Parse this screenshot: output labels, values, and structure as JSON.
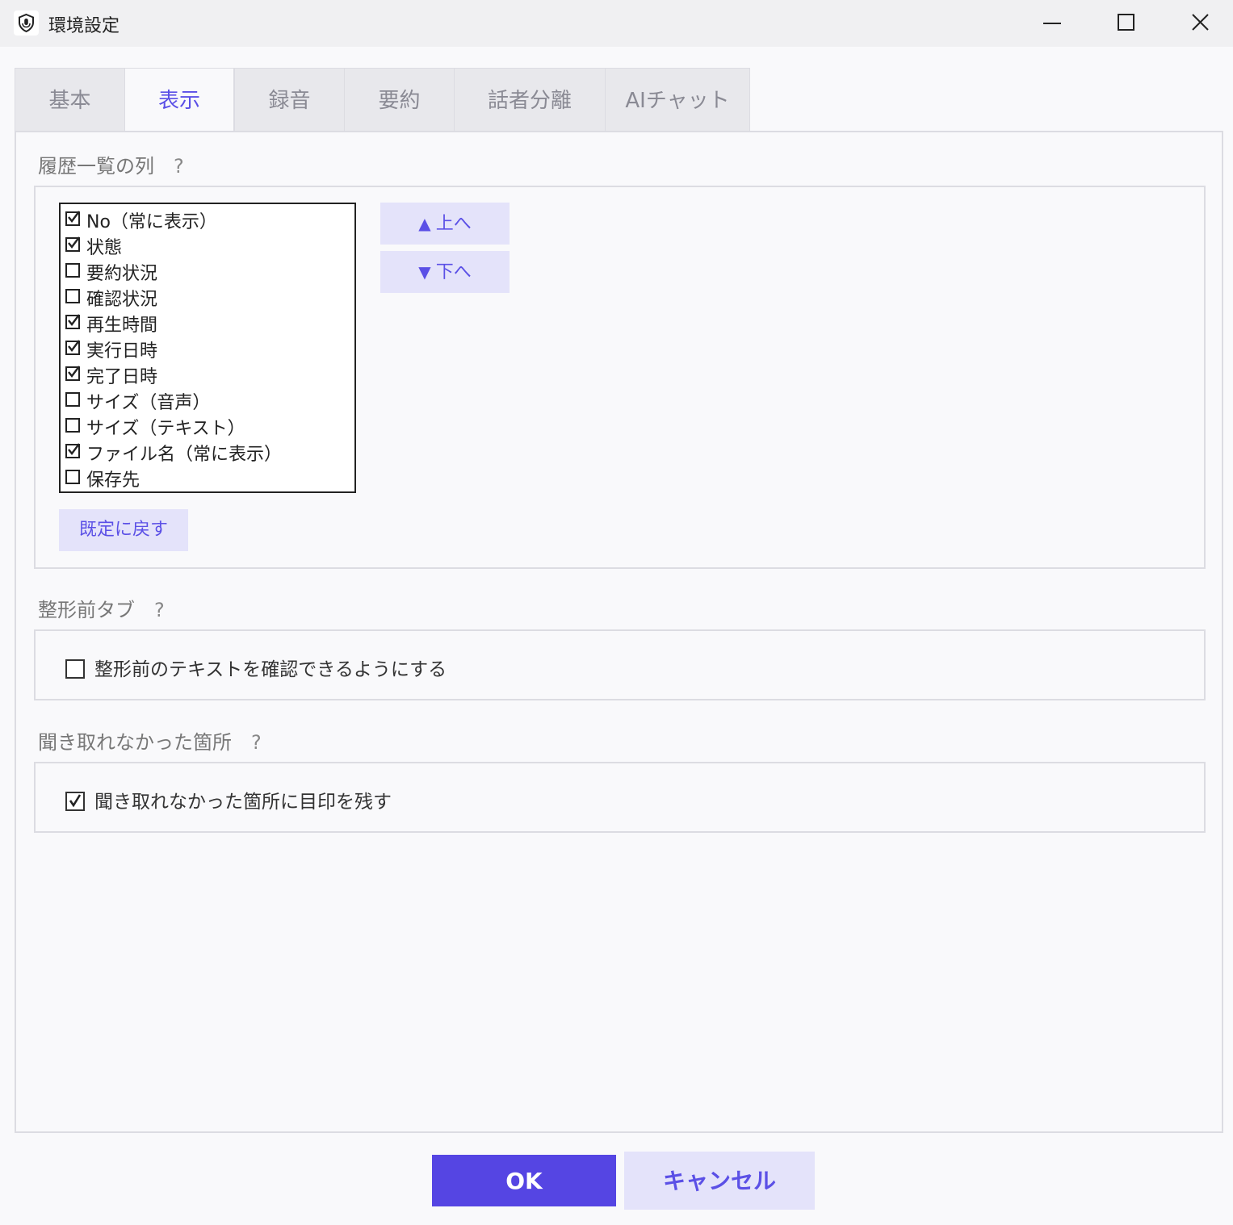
{
  "window": {
    "title": "環境設定",
    "icon": "shield-mic-icon",
    "controls": [
      "minimize-icon",
      "maximize-icon",
      "close-icon"
    ]
  },
  "tabs": [
    {
      "label": "基本",
      "active": false
    },
    {
      "label": "表示",
      "active": true
    },
    {
      "label": "録音",
      "active": false
    },
    {
      "label": "要約",
      "active": false
    },
    {
      "label": "話者分離",
      "active": false
    },
    {
      "label": "AIチャット",
      "active": false
    }
  ],
  "columns_section": {
    "title": "履歴一覧の列",
    "help": "?",
    "items": [
      {
        "label": "No（常に表示）",
        "checked": true
      },
      {
        "label": "状態",
        "checked": true
      },
      {
        "label": "要約状況",
        "checked": false
      },
      {
        "label": "確認状況",
        "checked": false
      },
      {
        "label": "再生時間",
        "checked": true
      },
      {
        "label": "実行日時",
        "checked": true
      },
      {
        "label": "完了日時",
        "checked": true
      },
      {
        "label": "サイズ（音声）",
        "checked": false
      },
      {
        "label": "サイズ（テキスト）",
        "checked": false
      },
      {
        "label": "ファイル名（常に表示）",
        "checked": true
      },
      {
        "label": "保存先",
        "checked": false
      }
    ],
    "up_button": {
      "arrow": "▲",
      "label": "上へ"
    },
    "down_button": {
      "arrow": "▼",
      "label": "下へ"
    },
    "reset_button": "既定に戻す"
  },
  "preformat_section": {
    "title": "整形前タブ",
    "help": "?",
    "option": {
      "label": "整形前のテキストを確認できるようにする",
      "checked": false
    }
  },
  "inaudible_section": {
    "title": "聞き取れなかった箇所",
    "help": "?",
    "option": {
      "label": "聞き取れなかった箇所に目印を残す",
      "checked": true
    }
  },
  "footer": {
    "ok": "OK",
    "cancel": "キャンセル"
  },
  "colors": {
    "accent": "#5545e3",
    "accent_light": "#e4e3fa",
    "accent_text": "#5b50e6"
  }
}
